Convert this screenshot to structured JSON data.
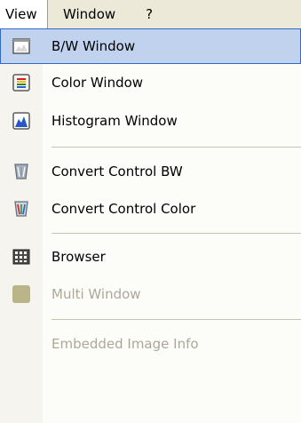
{
  "menubar": {
    "items": [
      "View",
      "Window",
      "?"
    ]
  },
  "menu": {
    "items": [
      {
        "label": "B/W Window",
        "icon": "bw-window-icon",
        "selected": true,
        "disabled": false
      },
      {
        "label": "Color Window",
        "icon": "color-window-icon",
        "selected": false,
        "disabled": false
      },
      {
        "label": "Histogram Window",
        "icon": "histogram-window-icon",
        "selected": false,
        "disabled": false
      },
      {
        "label": "Convert Control BW",
        "icon": "convert-control-bw-icon",
        "selected": false,
        "disabled": false
      },
      {
        "label": "Convert Control Color",
        "icon": "convert-control-color-icon",
        "selected": false,
        "disabled": false
      },
      {
        "label": "Browser",
        "icon": "browser-icon",
        "selected": false,
        "disabled": false
      },
      {
        "label": "Multi Window",
        "icon": "multi-window-icon",
        "selected": false,
        "disabled": true
      },
      {
        "label": "Embedded Image Info",
        "icon": "",
        "selected": false,
        "disabled": true
      }
    ]
  },
  "colors": {
    "menubar_background": "#ece9d8",
    "menu_background": "#fcfcf9",
    "selection_fill": "#c1d2ee",
    "selection_border": "#316ac5",
    "disabled_text": "#aca899"
  }
}
